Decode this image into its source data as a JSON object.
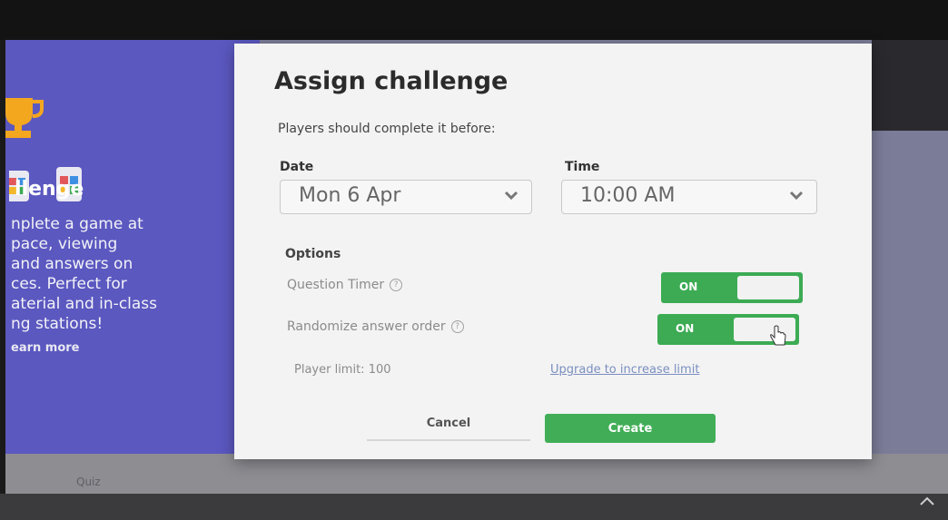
{
  "left_panel": {
    "title": "llenge",
    "description": "nplete a game at\n pace, viewing\nand answers on\nces. Perfect for\naterial and in-class\nng stations!",
    "learn_more": "earn more",
    "icons": [
      "trophy-icon",
      "game-cards-icon"
    ]
  },
  "footer": {
    "quiz_label": "Quiz"
  },
  "modal": {
    "title": "Assign challenge",
    "subtitle": "Players should complete it before:",
    "date": {
      "label": "Date",
      "value": "Mon 6 Apr"
    },
    "time": {
      "label": "Time",
      "value": "10:00 AM"
    },
    "options_title": "Options",
    "options": [
      {
        "label": "Question Timer",
        "state": "ON"
      },
      {
        "label": "Randomize answer order",
        "state": "ON"
      }
    ],
    "player_limit": "Player limit: 100",
    "upgrade_link": "Upgrade to increase limit",
    "cancel_label": "Cancel",
    "create_label": "Create"
  },
  "colors": {
    "accent_green": "#41ae57",
    "panel_purple": "#5b58c0",
    "modal_bg": "#f3f3f3"
  }
}
